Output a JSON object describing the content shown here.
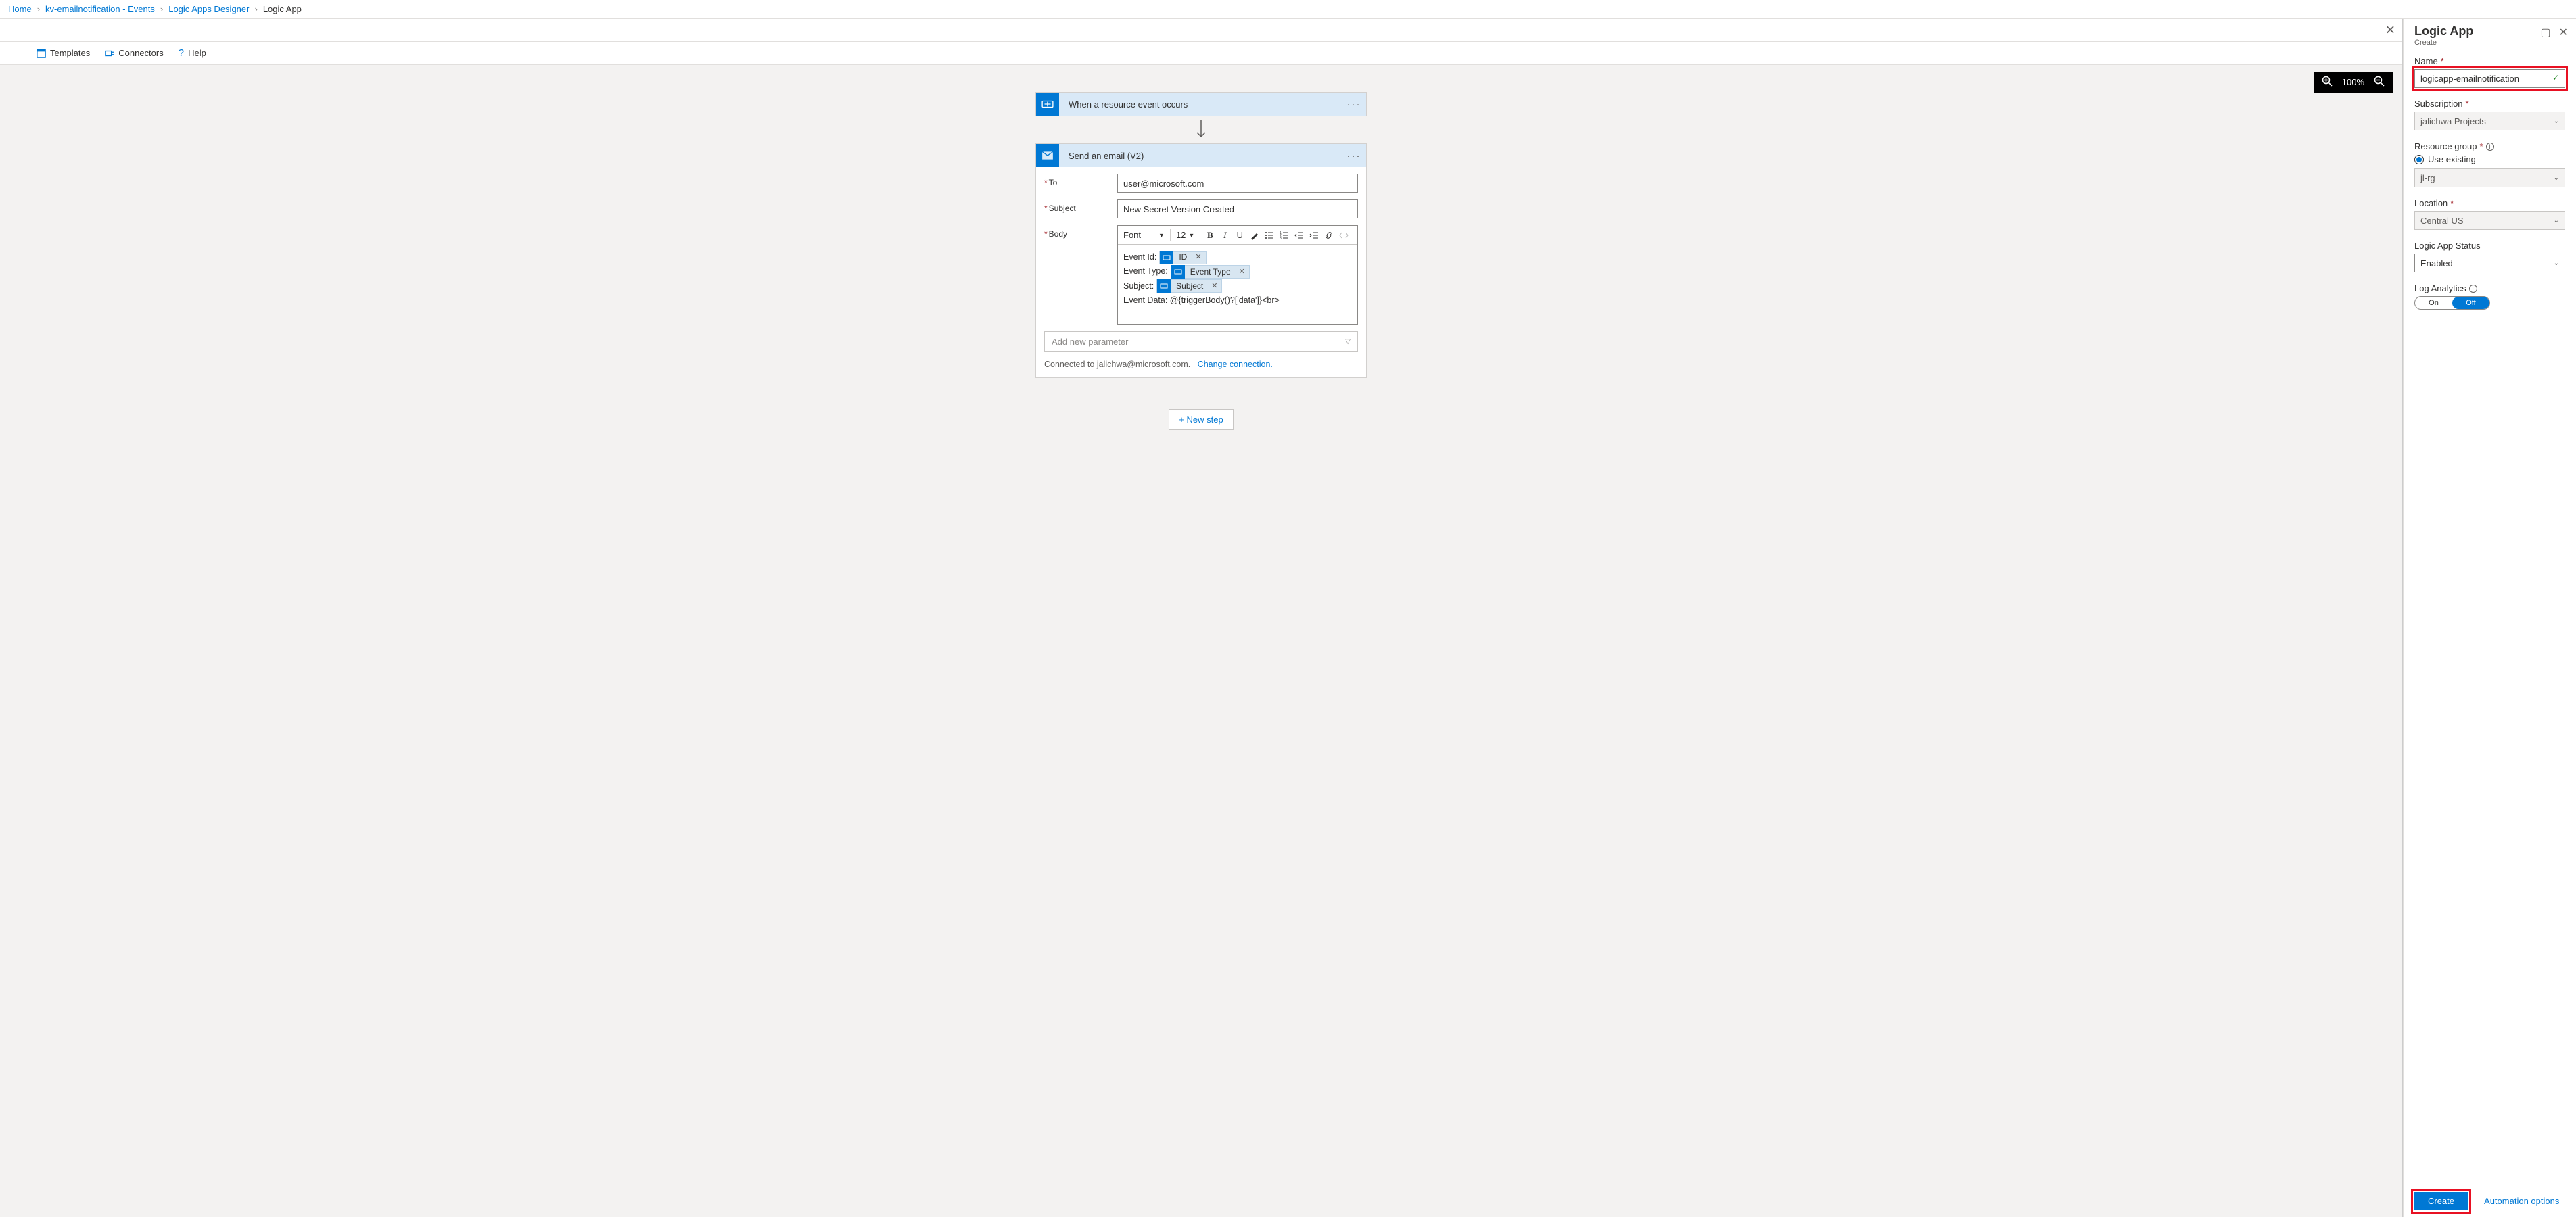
{
  "breadcrumbs": {
    "home": "Home",
    "kv": "kv-emailnotification - Events",
    "designer": "Logic Apps Designer",
    "current": "Logic App"
  },
  "toolbar": {
    "templates": "Templates",
    "connectors": "Connectors",
    "help": "Help"
  },
  "zoom": {
    "level": "100%"
  },
  "trigger": {
    "title": "When a resource event occurs"
  },
  "email": {
    "title": "Send an email (V2)",
    "to_label": "To",
    "to_value": "user@microsoft.com",
    "subject_label": "Subject",
    "subject_value": "New Secret Version Created",
    "body_label": "Body",
    "font_label": "Font",
    "font_size": "12",
    "body_lines": {
      "l1": "Event Id:",
      "l2": "Event Type:",
      "l3": "Subject:",
      "l4": "Event Data: @{triggerBody()?['data']}<br>"
    },
    "tokens": {
      "id": "ID",
      "event_type": "Event Type",
      "subject": "Subject"
    },
    "add_param": "Add new parameter",
    "connected_prefix": "Connected to jalichwa@microsoft.com.",
    "change_conn": "Change connection."
  },
  "new_step": "+ New step",
  "side": {
    "title": "Logic App",
    "subtitle": "Create",
    "name_label": "Name",
    "name_value": "logicapp-emailnotification",
    "subscription_label": "Subscription",
    "subscription_value": "jalichwa Projects",
    "rg_label": "Resource group",
    "rg_radio": "Use existing",
    "rg_value": "jl-rg",
    "location_label": "Location",
    "location_value": "Central US",
    "status_label": "Logic App Status",
    "status_value": "Enabled",
    "analytics_label": "Log Analytics",
    "toggle_on": "On",
    "toggle_off": "Off",
    "create": "Create",
    "automation": "Automation options"
  }
}
